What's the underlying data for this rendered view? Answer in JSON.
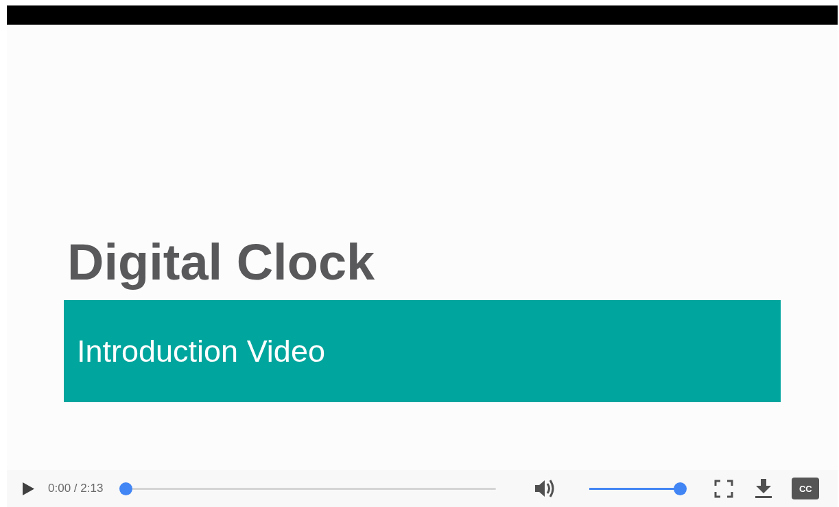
{
  "slide": {
    "title": "Digital Clock",
    "subtitle": "Introduction Video"
  },
  "controls": {
    "time": "0:00 / 2:13",
    "progress": {
      "level": 0
    },
    "volume": {
      "level": 1
    },
    "captions_label": "CC"
  }
}
